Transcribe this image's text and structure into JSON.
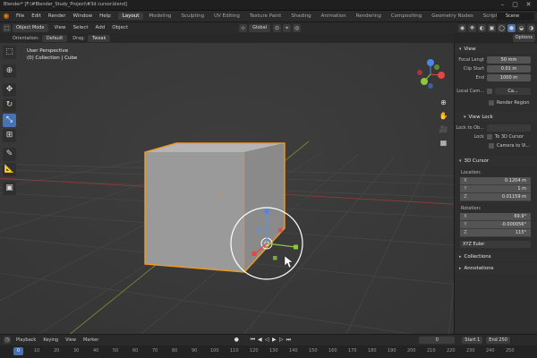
{
  "window": {
    "title": "Blender* [F:\\#Blender_Study_Project\\#3d cursor.blend]"
  },
  "menubar": {
    "menus": [
      "File",
      "Edit",
      "Render",
      "Window",
      "Help"
    ],
    "workspaces": [
      "Layout",
      "Modeling",
      "Sculpting",
      "UV Editing",
      "Texture Paint",
      "Shading",
      "Animation",
      "Rendering",
      "Compositing",
      "Geometry Nodes",
      "Scripting"
    ],
    "active_workspace": "Layout",
    "scene": "Scene"
  },
  "header": {
    "mode": "Object Mode",
    "menus": [
      "View",
      "Select",
      "Add",
      "Object"
    ],
    "transform_orientation": "Global"
  },
  "subheader": {
    "orientation_label": "Orientation:",
    "orientation_value": "Default",
    "drag_label": "Drag:",
    "drag_value": "Tweak"
  },
  "viewport": {
    "view_name": "User Perspective",
    "collection_info": "(0) Collection | Cube",
    "accent_orange": "#f39a1c"
  },
  "toolbar": {
    "tools": [
      "select-box-icon",
      "cursor-icon",
      "move-icon",
      "rotate-icon",
      "scale-icon",
      "transform-icon",
      "annotate-icon",
      "measure-icon",
      "add-cube-icon"
    ],
    "active_tool": "scale-icon"
  },
  "npanel": {
    "options_label": "Options",
    "view_section": {
      "title": "View",
      "focal_length_label": "Focal Lengt",
      "focal_length": "50 mm",
      "clip_start_label": "Clip Start",
      "clip_start": "0.01 m",
      "end_label": "End",
      "end": "1000 m",
      "local_camera_label": "Local Cam...",
      "local_camera_value": "Ca...",
      "render_region_label": "Render Region"
    },
    "view_lock": {
      "title": "View Lock",
      "lock_to_object_label": "Lock to Ob...",
      "lock_label": "Lock",
      "to_3d_cursor": "To 3D Cursor",
      "camera_to_view": "Camera to Vi..."
    },
    "cursor_section": {
      "title": "3D Cursor",
      "location_label": "Location:",
      "location": {
        "x": "0.1204 m",
        "y": "1 m",
        "z": "0.01159 m"
      },
      "rotation_label": "Rotation:",
      "rotation": {
        "x": "69.9°",
        "y": "-0.000056°",
        "z": "115°"
      },
      "rotation_mode": "XYZ Euler"
    },
    "collections_title": "Collections",
    "annotations_title": "Annotations"
  },
  "timeline": {
    "menus": [
      "Playback",
      "Keying",
      "View",
      "Marker"
    ],
    "current_frame": "0",
    "start_label": "Start",
    "start": "1",
    "end_label": "End",
    "end": "250"
  },
  "ruler": {
    "current": "0",
    "ticks": [
      "10",
      "20",
      "30",
      "40",
      "50",
      "60",
      "70",
      "80",
      "90",
      "100",
      "110",
      "120",
      "130",
      "140",
      "150",
      "160",
      "170",
      "180",
      "190",
      "200",
      "210",
      "220",
      "230",
      "240",
      "250"
    ]
  }
}
